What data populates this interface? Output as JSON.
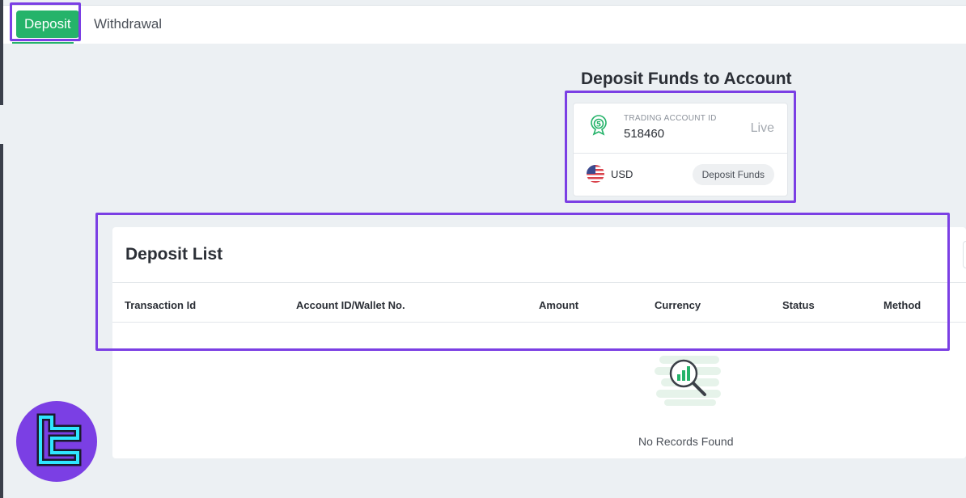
{
  "tabs": {
    "deposit_label": "Deposit",
    "withdrawal_label": "Withdrawal",
    "active": "Deposit"
  },
  "deposit_section": {
    "title": "Deposit Funds to Account",
    "account_label": "TRADING ACCOUNT ID",
    "account_id": "518460",
    "account_type": "Live",
    "currency": "USD",
    "deposit_button": "Deposit Funds"
  },
  "deposit_list": {
    "title": "Deposit List",
    "columns": [
      "Transaction Id",
      "Account ID/Wallet No.",
      "Amount",
      "Currency",
      "Status",
      "Method"
    ],
    "empty_message": "No Records Found"
  },
  "icons": {
    "platform": "mt5-icon",
    "flag": "us-flag-icon",
    "empty_state": "magnifier-chart-icon",
    "brand": "tc-logo"
  },
  "colors": {
    "accent_green": "#25b36a",
    "highlight_purple": "#7b3fe4",
    "page_bg": "#ecf0f3",
    "logo_cyan": "#2fe6ff"
  }
}
